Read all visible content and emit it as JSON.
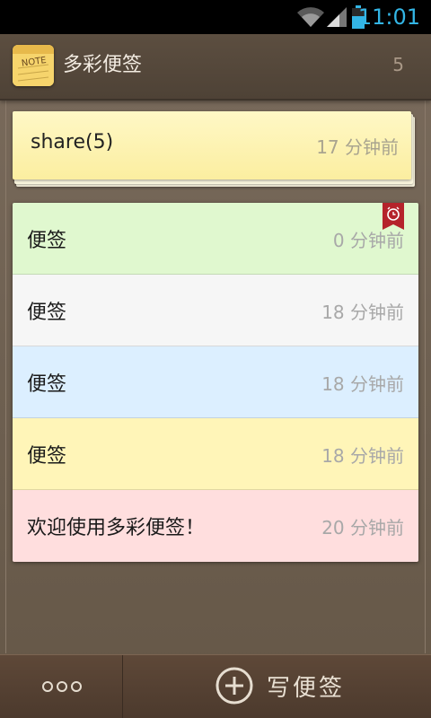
{
  "status_bar": {
    "time": "11:01",
    "icons": [
      "wifi-icon",
      "signal-icon",
      "battery-icon"
    ],
    "accent": "#33b5e5"
  },
  "header": {
    "title": "多彩便签",
    "count": "5",
    "icon": "note-app-icon",
    "icon_text": "NOTE"
  },
  "folder": {
    "name": "share(5)",
    "time": "17 分钟前",
    "color": "#fbeea0"
  },
  "notes": [
    {
      "title": "便签",
      "time": "0 分钟前",
      "color": "#e0f8cf",
      "alarm": true
    },
    {
      "title": "便签",
      "time": "18 分钟前",
      "color": "#f6f6f6",
      "alarm": false
    },
    {
      "title": "便签",
      "time": "18 分钟前",
      "color": "#dcefff",
      "alarm": false
    },
    {
      "title": "便签",
      "time": "18 分钟前",
      "color": "#fff5b8",
      "alarm": false
    },
    {
      "title": "欢迎使用多彩便签！",
      "time": "20 分钟前",
      "color": "#ffdede",
      "alarm": false
    }
  ],
  "bottom_bar": {
    "more_icon": "more-dots-icon",
    "compose_icon": "add-circle-icon",
    "compose_label": "写便签"
  }
}
